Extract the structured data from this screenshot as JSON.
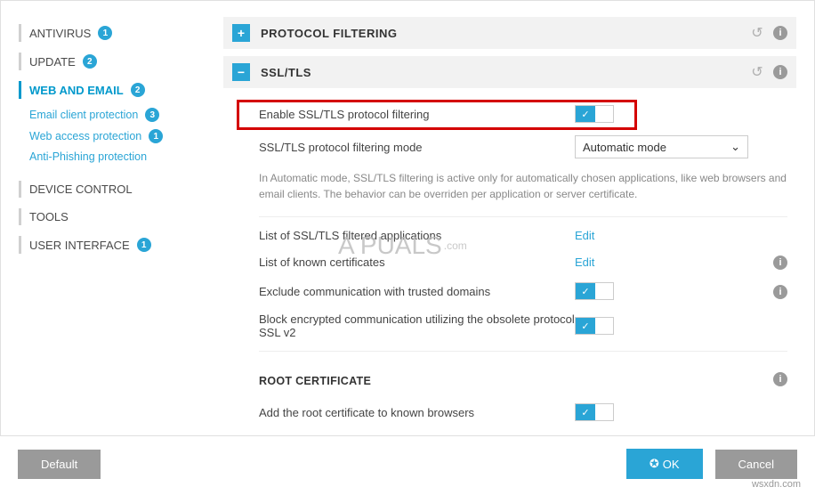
{
  "sidebar": {
    "items": [
      {
        "label": "ANTIVIRUS",
        "badge": "1"
      },
      {
        "label": "UPDATE",
        "badge": "2"
      },
      {
        "label": "WEB AND EMAIL",
        "badge": "2"
      },
      {
        "label": "DEVICE CONTROL"
      },
      {
        "label": "TOOLS"
      },
      {
        "label": "USER INTERFACE",
        "badge": "1"
      }
    ],
    "subitems": [
      {
        "label": "Email client protection",
        "badge": "3"
      },
      {
        "label": "Web access protection",
        "badge": "1"
      },
      {
        "label": "Anti-Phishing protection"
      }
    ]
  },
  "sections": {
    "protocol": {
      "title": "PROTOCOL FILTERING"
    },
    "ssl": {
      "title": "SSL/TLS",
      "enable_label": "Enable SSL/TLS protocol filtering",
      "mode_label": "SSL/TLS protocol filtering mode",
      "mode_value": "Automatic mode",
      "note": "In Automatic mode, SSL/TLS filtering is active only for automatically chosen applications, like web browsers and email clients. The behavior can be overriden per application or server certificate.",
      "list_apps": "List of SSL/TLS filtered applications",
      "list_certs": "List of known certificates",
      "edit": "Edit",
      "exclude": "Exclude communication with trusted domains",
      "block": "Block encrypted communication utilizing the obsolete protocol SSL v2"
    },
    "root": {
      "title": "ROOT CERTIFICATE",
      "add": "Add the root certificate to known browsers"
    }
  },
  "footer": {
    "default": "Default",
    "ok": "OK",
    "cancel": "Cancel"
  },
  "watermark": {
    "brand": "A   PUALS",
    "tag": ".com",
    "url": "wsxdn.com"
  }
}
